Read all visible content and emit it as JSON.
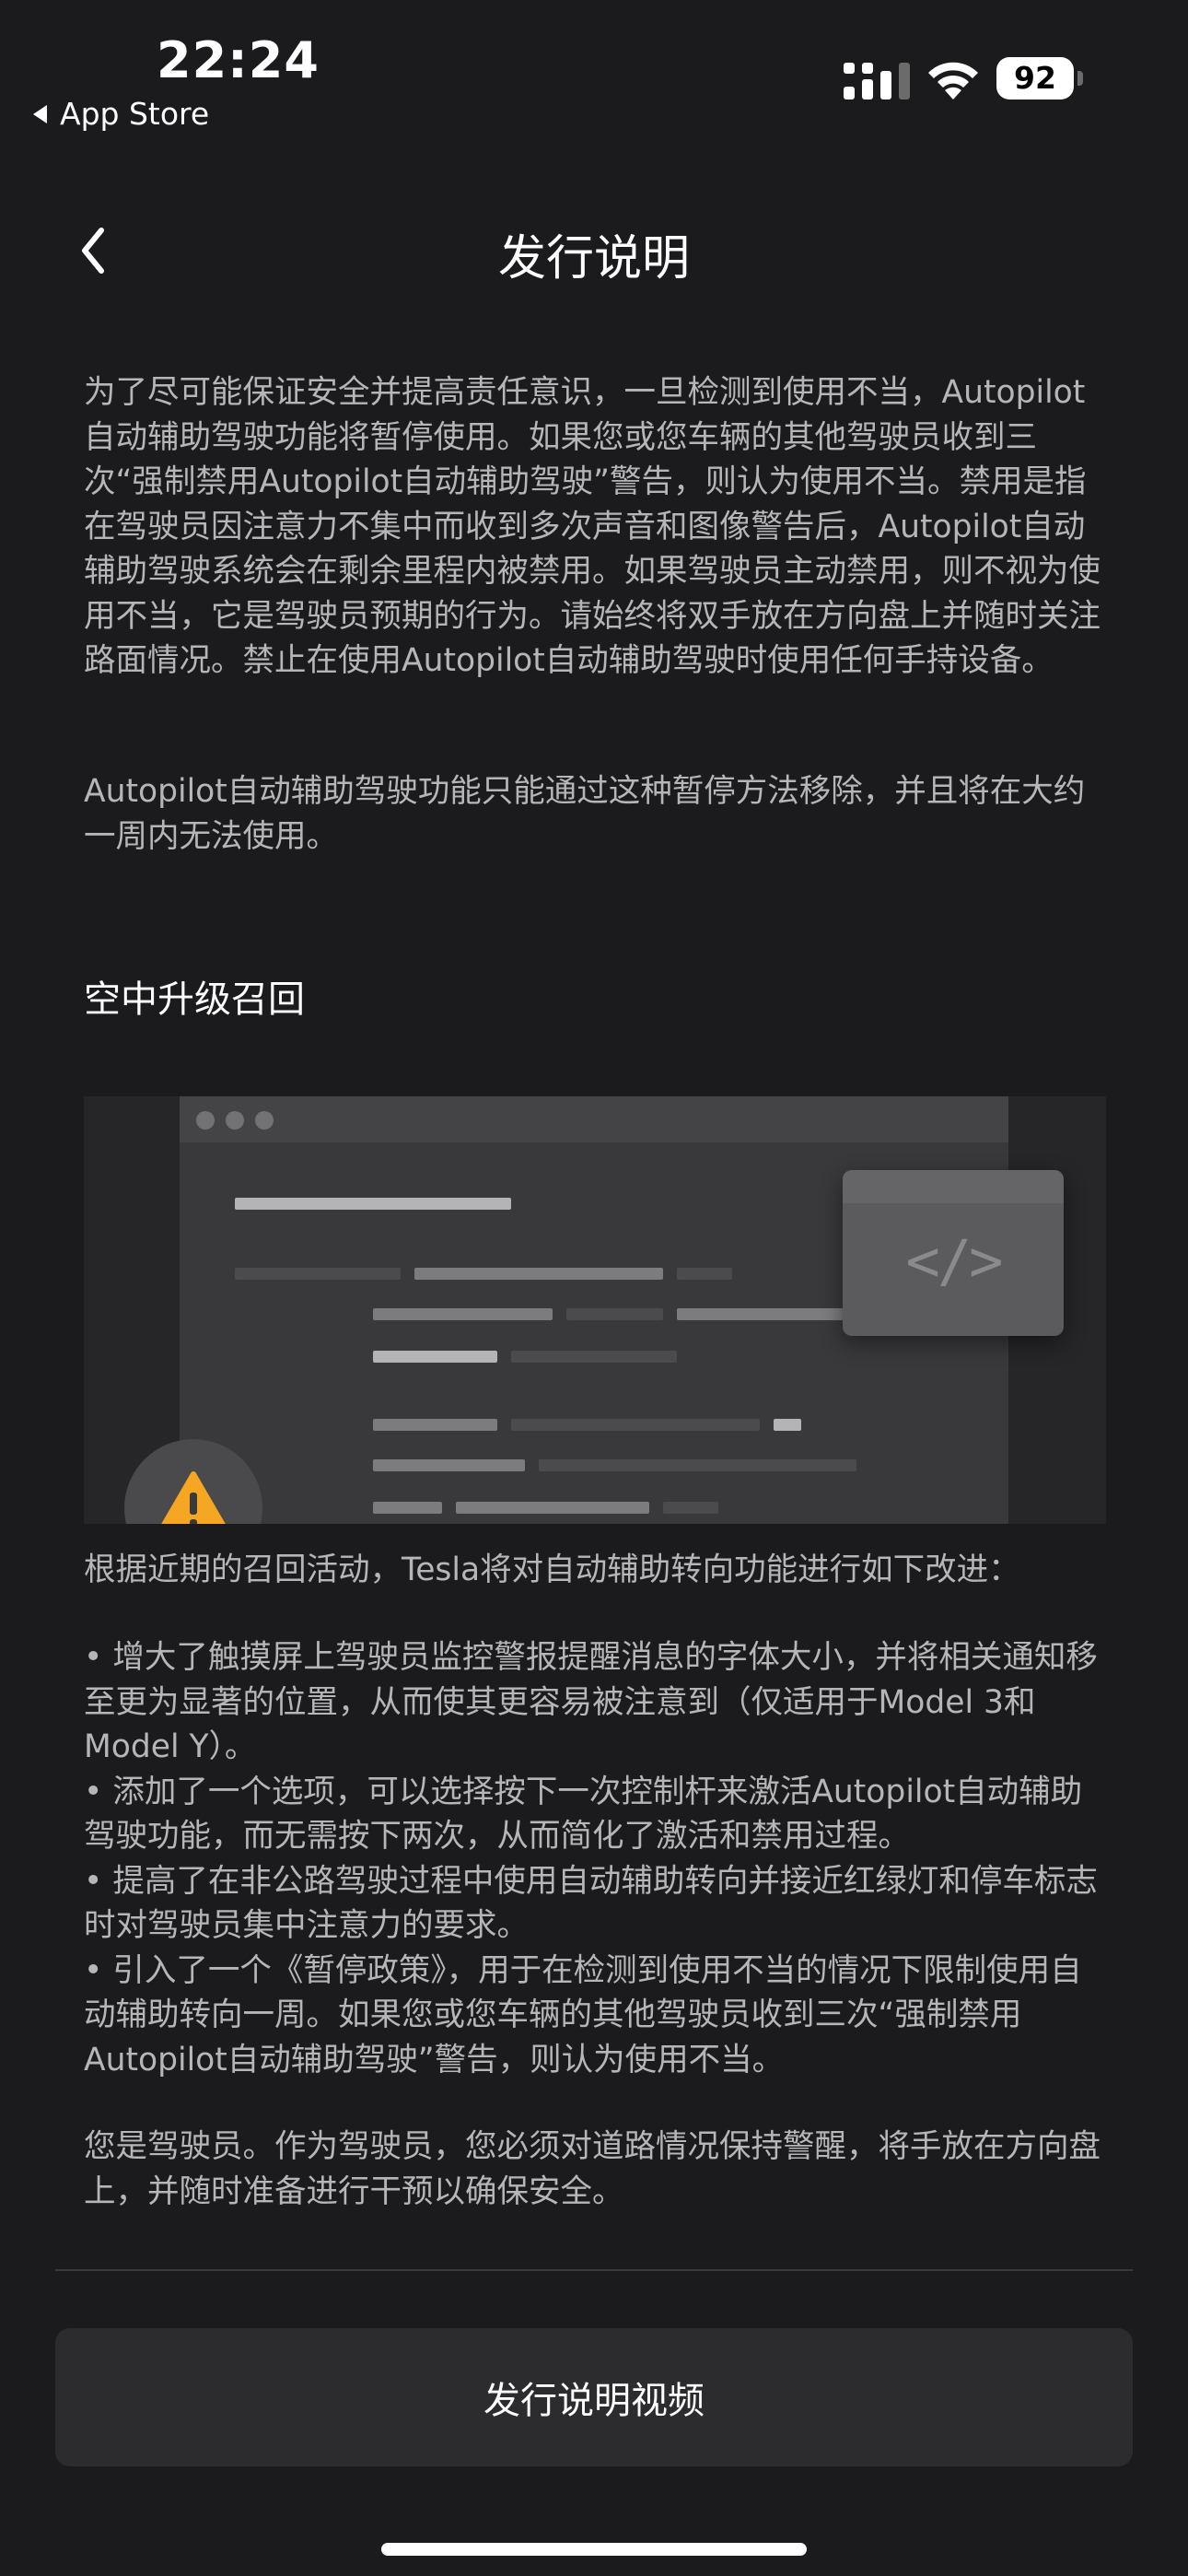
{
  "status_bar": {
    "time": "22:24",
    "back_app": "App Store",
    "battery": "92",
    "icons": [
      "signal-icon",
      "wifi-icon",
      "battery-icon"
    ]
  },
  "header": {
    "title": "发行说明",
    "back_icon": "chevron-left-icon"
  },
  "intro": {
    "paragraph1": "为了尽可能保证安全并提高责任意识，一旦检测到使用不当，Autopilot自动辅助驾驶功能将暂停使用。如果您或您车辆的其他驾驶员收到三次“强制禁用Autopilot自动辅助驾驶”警告，则认为使用不当。禁用是指在驾驶员因注意力不集中而收到多次声音和图像警告后，Autopilot自动辅助驾驶系统会在剩余里程内被禁用。如果驾驶员主动禁用，则不视为使用不当，它是驾驶员预期的行为。请始终将双手放在方向盘上并随时关注路面情况。禁止在使用Autopilot自动辅助驾驶时使用任何手持设备。",
    "paragraph2": "Autopilot自动辅助驾驶功能只能通过这种暂停方法移除，并且将在大约一周内无法使用。"
  },
  "section": {
    "title": "空中升级召回",
    "illustration": {
      "code_glyph": "</>",
      "icons": [
        "code-icon",
        "warning-icon"
      ]
    },
    "lead": "根据近期的召回活动，Tesla将对自动辅助转向功能进行如下改进：",
    "bullets": [
      "• 增大了触摸屏上驾驶员监控警报提醒消息的字体大小，并将相关通知移至更为显著的位置，从而使其更容易被注意到（仅适用于Model 3和Model Y）。",
      "• 添加了一个选项，可以选择按下一次控制杆来激活Autopilot自动辅助驾驶功能，而无需按下两次，从而简化了激活和禁用过程。",
      "• 提高了在非公路驾驶过程中使用自动辅助转向并接近红绿灯和停车标志时对驾驶员集中注意力的要求。",
      "• 引入了一个《暂停政策》，用于在检测到使用不当的情况下限制使用自动辅助转向一周。如果您或您车辆的其他驾驶员收到三次“强制禁用Autopilot自动辅助驾驶”警告，则认为使用不当。"
    ],
    "closing": "您是驾驶员。作为驾驶员，您必须对道路情况保持警醒，将手放在方向盘上，并随时准备进行干预以确保安全。"
  },
  "footer": {
    "video_button": "发行说明视频"
  },
  "colors": {
    "background": "#1b1b1d",
    "body_text": "#b6b6b8",
    "warning": "#f5a623",
    "button_bg": "#2c2c2e"
  }
}
